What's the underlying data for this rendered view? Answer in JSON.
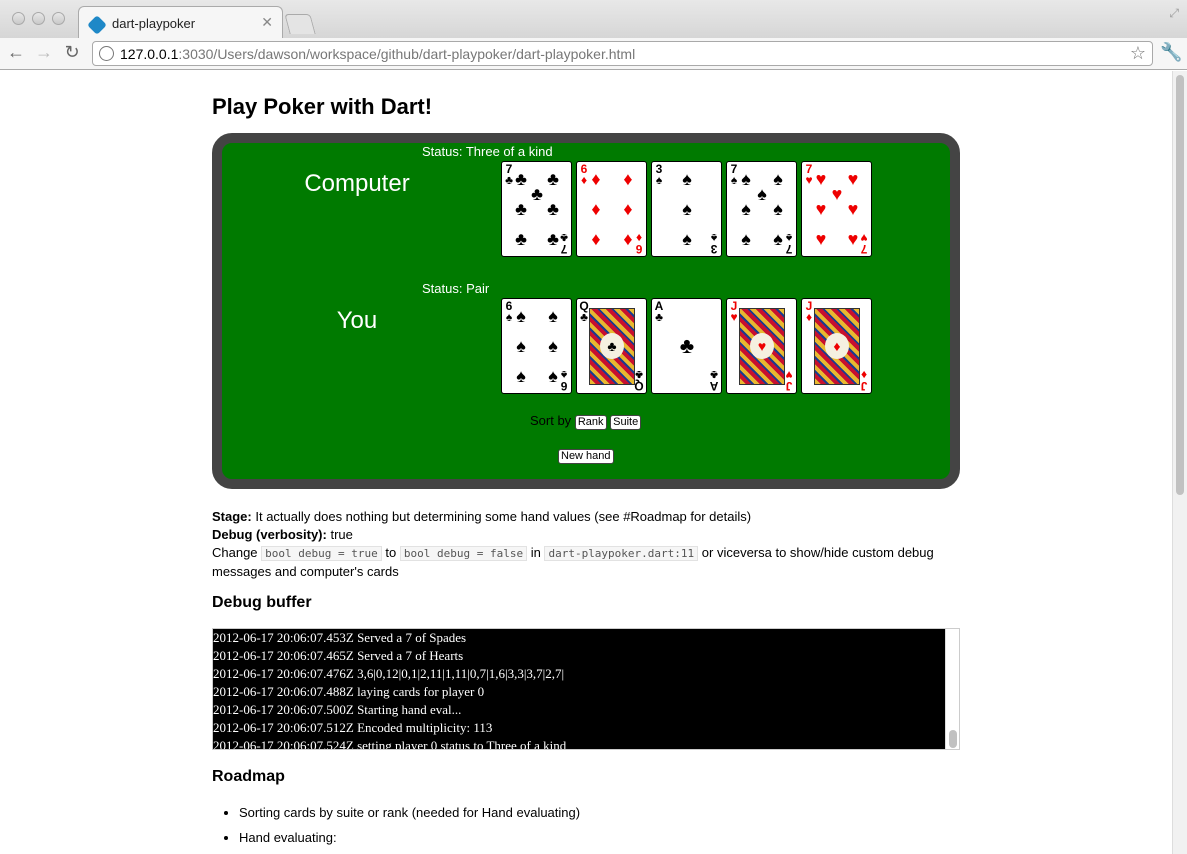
{
  "browser": {
    "tab_title": "dart-playpoker",
    "url_host": "127.0.0.1",
    "url_rest": ":3030/Users/dawson/workspace/github/dart-playpoker/dart-playpoker.html"
  },
  "page": {
    "title": "Play Poker with Dart!",
    "computer": {
      "label": "Computer",
      "status": "Status: Three of a kind",
      "cards": [
        {
          "rank": "7",
          "suit": "♣",
          "color": "#000000"
        },
        {
          "rank": "6",
          "suit": "♦",
          "color": "#ee0000"
        },
        {
          "rank": "3",
          "suit": "♠",
          "color": "#000000"
        },
        {
          "rank": "7",
          "suit": "♠",
          "color": "#000000"
        },
        {
          "rank": "7",
          "suit": "♥",
          "color": "#ee0000"
        }
      ]
    },
    "player": {
      "label": "You",
      "status": "Status: Pair",
      "cards": [
        {
          "rank": "6",
          "suit": "♠",
          "color": "#000000"
        },
        {
          "rank": "Q",
          "suit": "♣",
          "color": "#000000"
        },
        {
          "rank": "A",
          "suit": "♣",
          "color": "#000000"
        },
        {
          "rank": "J",
          "suit": "♥",
          "color": "#ee0000"
        },
        {
          "rank": "J",
          "suit": "♦",
          "color": "#ee0000"
        }
      ]
    },
    "sort_label": "Sort by",
    "rank_button": "Rank",
    "suite_button": "Suite",
    "new_hand_button": "New hand",
    "stage_label": "Stage:",
    "stage_text": "It actually does nothing but determining some hand values (see #Roadmap for details)",
    "debug_label": "Debug (verbosity):",
    "debug_value": "true",
    "change_prefix": "Change",
    "code_true": "bool debug = true",
    "to": "to",
    "code_false": "bool debug = false",
    "in": "in",
    "code_file": "dart-playpoker.dart:11",
    "change_suffix": "or viceversa to show/hide custom debug messages and computer's cards",
    "debug_heading": "Debug buffer",
    "debug_lines": [
      "2012-06-17 20:06:07.453Z Served a 7 of Spades",
      "2012-06-17 20:06:07.465Z Served a 7 of Hearts",
      "2012-06-17 20:06:07.476Z 3,6|0,12|0,1|2,11|1,11|0,7|1,6|3,3|3,7|2,7|",
      "2012-06-17 20:06:07.488Z laying cards for player 0",
      "2012-06-17 20:06:07.500Z Starting hand eval...",
      "2012-06-17 20:06:07.512Z Encoded multiplicity: 113",
      "2012-06-17 20:06:07.524Z setting player 0 status to Three of a kind"
    ],
    "roadmap_heading": "Roadmap",
    "roadmap_items": [
      "Sorting cards by suite or rank (needed for Hand evaluating)",
      "Hand evaluating:"
    ]
  }
}
